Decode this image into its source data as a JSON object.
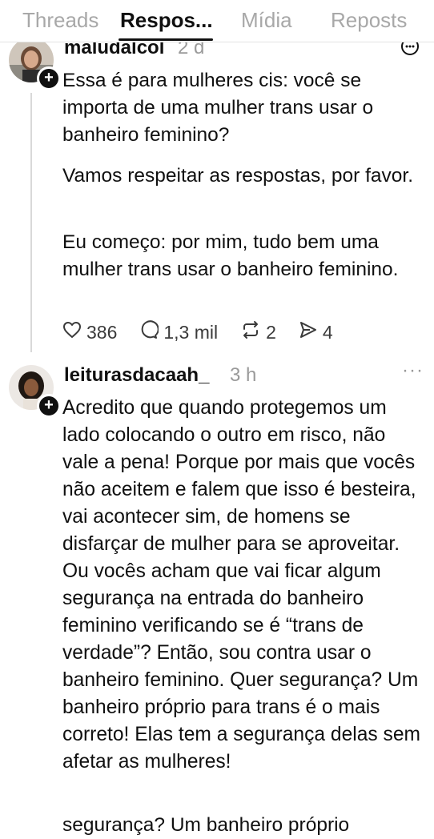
{
  "tabs": [
    {
      "label": "Threads",
      "active": false
    },
    {
      "label": "Respos...",
      "active": true
    },
    {
      "label": "Mídia",
      "active": false
    },
    {
      "label": "Reposts",
      "active": false
    }
  ],
  "post1": {
    "username": "maludalcol",
    "time": "2 d",
    "paragraphs": [
      "Essa é para mulheres cis: você se importa de uma mulher trans usar o banheiro feminino?",
      "Vamos respeitar as respostas, por favor.",
      "Eu começo: por mim, tudo bem uma mulher trans usar o banheiro feminino."
    ],
    "likes": "386",
    "replies": "1,3 mil",
    "reposts": "2",
    "shares": "4"
  },
  "post2": {
    "username": "leiturasdacaah_",
    "time": "3 h",
    "more": "···",
    "text": "Acredito que quando protegemos um lado colocando o outro em risco, não vale a pena! Porque por mais que vocês não aceitem e falem que isso é besteira, vai acontecer sim, de homens se disfarçar de mulher para se aproveitar. Ou vocês acham que vai ficar algum segurança na entrada do banheiro feminino verificando se é “trans de verdade”? Então, sou contra usar o banheiro feminino. Quer segurança? Um banheiro próprio para trans é o mais correto! Elas tem a segurança delas sem afetar as mulheres!",
    "cut_line": "segurança? Um banheiro próprio"
  },
  "icons": {
    "like": "heart-icon",
    "reply": "comment-icon",
    "repost": "repost-icon",
    "share": "share-icon",
    "follow": "plus-icon",
    "more": "more-icon"
  }
}
